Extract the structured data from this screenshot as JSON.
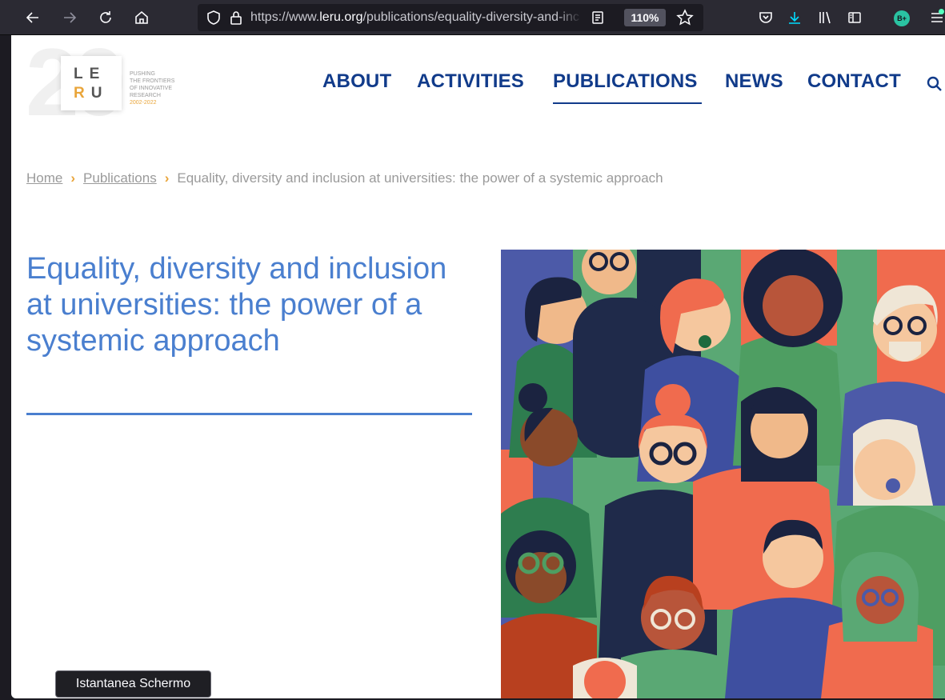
{
  "browser": {
    "url_prefix": "https://www.",
    "url_domain": "leru.org",
    "url_path": "/publications/equality-diversity-and-inclusion-at-universities-the-power-of-a-systemic-approach",
    "zoom": "110%",
    "profile_badge": "B+"
  },
  "logo": {
    "year_mark": "20",
    "letters_top": "LE",
    "letters_bottom_r": "R",
    "letters_bottom_u": "U",
    "tagline_1": "Pushing",
    "tagline_2": "the frontiers",
    "tagline_3": "of innovative",
    "tagline_4": "research",
    "tagline_years": "2002-2022"
  },
  "nav": {
    "items": [
      {
        "label": "ABOUT"
      },
      {
        "label": "ACTIVITIES"
      },
      {
        "label": "PUBLICATIONS"
      },
      {
        "label": "NEWS"
      },
      {
        "label": "CONTACT"
      }
    ],
    "active": "PUBLICATIONS"
  },
  "breadcrumb": {
    "home": "Home",
    "section": "Publications",
    "current": "Equality, diversity and inclusion at universities: the power of a systemic approach"
  },
  "page": {
    "title": "Equality, diversity and inclusion at universities: the power of a systemic approach"
  },
  "tooltip": {
    "text": "Istantanea Schermo"
  },
  "colors": {
    "nav": "#113b8a",
    "title": "#4a7fcf",
    "accent": "#e9a53a"
  }
}
